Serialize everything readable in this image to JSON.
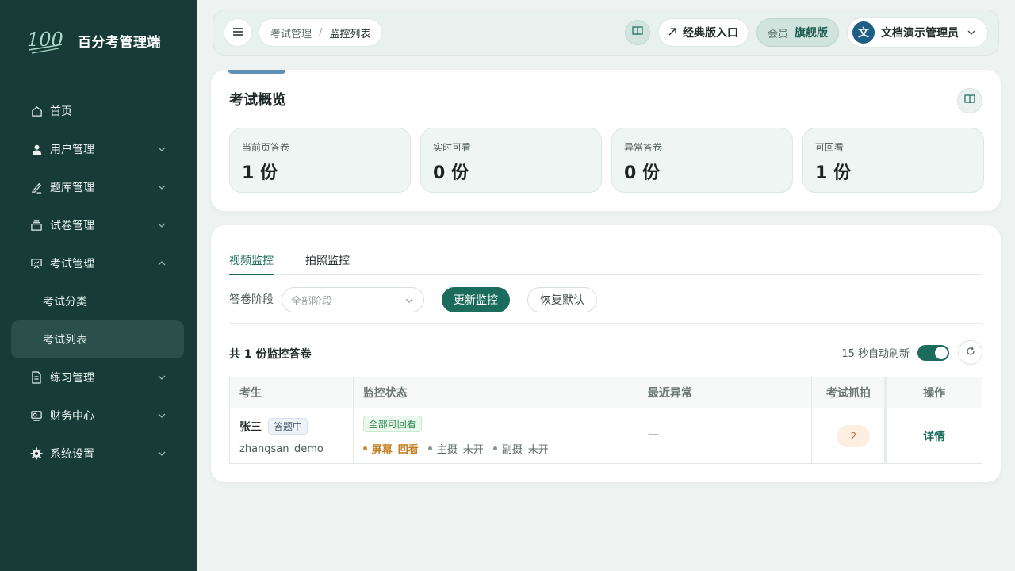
{
  "brand": {
    "logo_text": "100",
    "title": "百分考管理端"
  },
  "sidebar": {
    "items": [
      {
        "label": "首页",
        "icon": "home-icon"
      },
      {
        "label": "用户管理",
        "icon": "user-icon"
      },
      {
        "label": "题库管理",
        "icon": "pen-icon"
      },
      {
        "label": "试卷管理",
        "icon": "stack-icon"
      },
      {
        "label": "考试管理",
        "icon": "presentation-icon"
      },
      {
        "label": "练习管理",
        "icon": "document-icon"
      },
      {
        "label": "财务中心",
        "icon": "finance-icon"
      },
      {
        "label": "系统设置",
        "icon": "gear-icon"
      }
    ],
    "sub": [
      {
        "label": "考试分类"
      },
      {
        "label": "考试列表"
      }
    ]
  },
  "header": {
    "crumb1": "考试管理",
    "crumb_sep": "/",
    "crumb2": "监控列表",
    "classic_label": "经典版入口",
    "member_label": "会员",
    "member_level": "旗舰版",
    "avatar_char": "文",
    "user_name": "文档演示管理员"
  },
  "overview": {
    "title": "考试概览",
    "stats": [
      {
        "label": "当前页答卷",
        "value": "1 份"
      },
      {
        "label": "实时可看",
        "value": "0 份"
      },
      {
        "label": "异常答卷",
        "value": "0 份"
      },
      {
        "label": "可回看",
        "value": "1 份"
      }
    ]
  },
  "monitor": {
    "tabs": [
      "视频监控",
      "拍照监控"
    ],
    "filter_label": "答卷阶段",
    "select_placeholder": "全部阶段",
    "refresh_btn": "更新监控",
    "reset_btn": "恢复默认",
    "count_text": "共 1 份监控答卷",
    "auto_text": "15 秒自动刷新",
    "columns": [
      "考生",
      "监控状态",
      "最近异常",
      "考试抓拍",
      "操作"
    ],
    "rows": [
      {
        "name": "张三",
        "status_badge": "答题中",
        "username": "zhangsan_demo",
        "monitor_badge": "全部可回看",
        "screen_label": "屏幕",
        "screen_state": "回看",
        "main_label": "主摄",
        "main_state": "未开",
        "sub_label": "副摄",
        "sub_state": "未开",
        "last_abnormal": "—",
        "snapshots": "2",
        "action": "详情"
      }
    ]
  },
  "colors": {
    "sidebar": "#173c37",
    "primary": "#1b6c5d",
    "accent_orange": "#c5672d"
  }
}
